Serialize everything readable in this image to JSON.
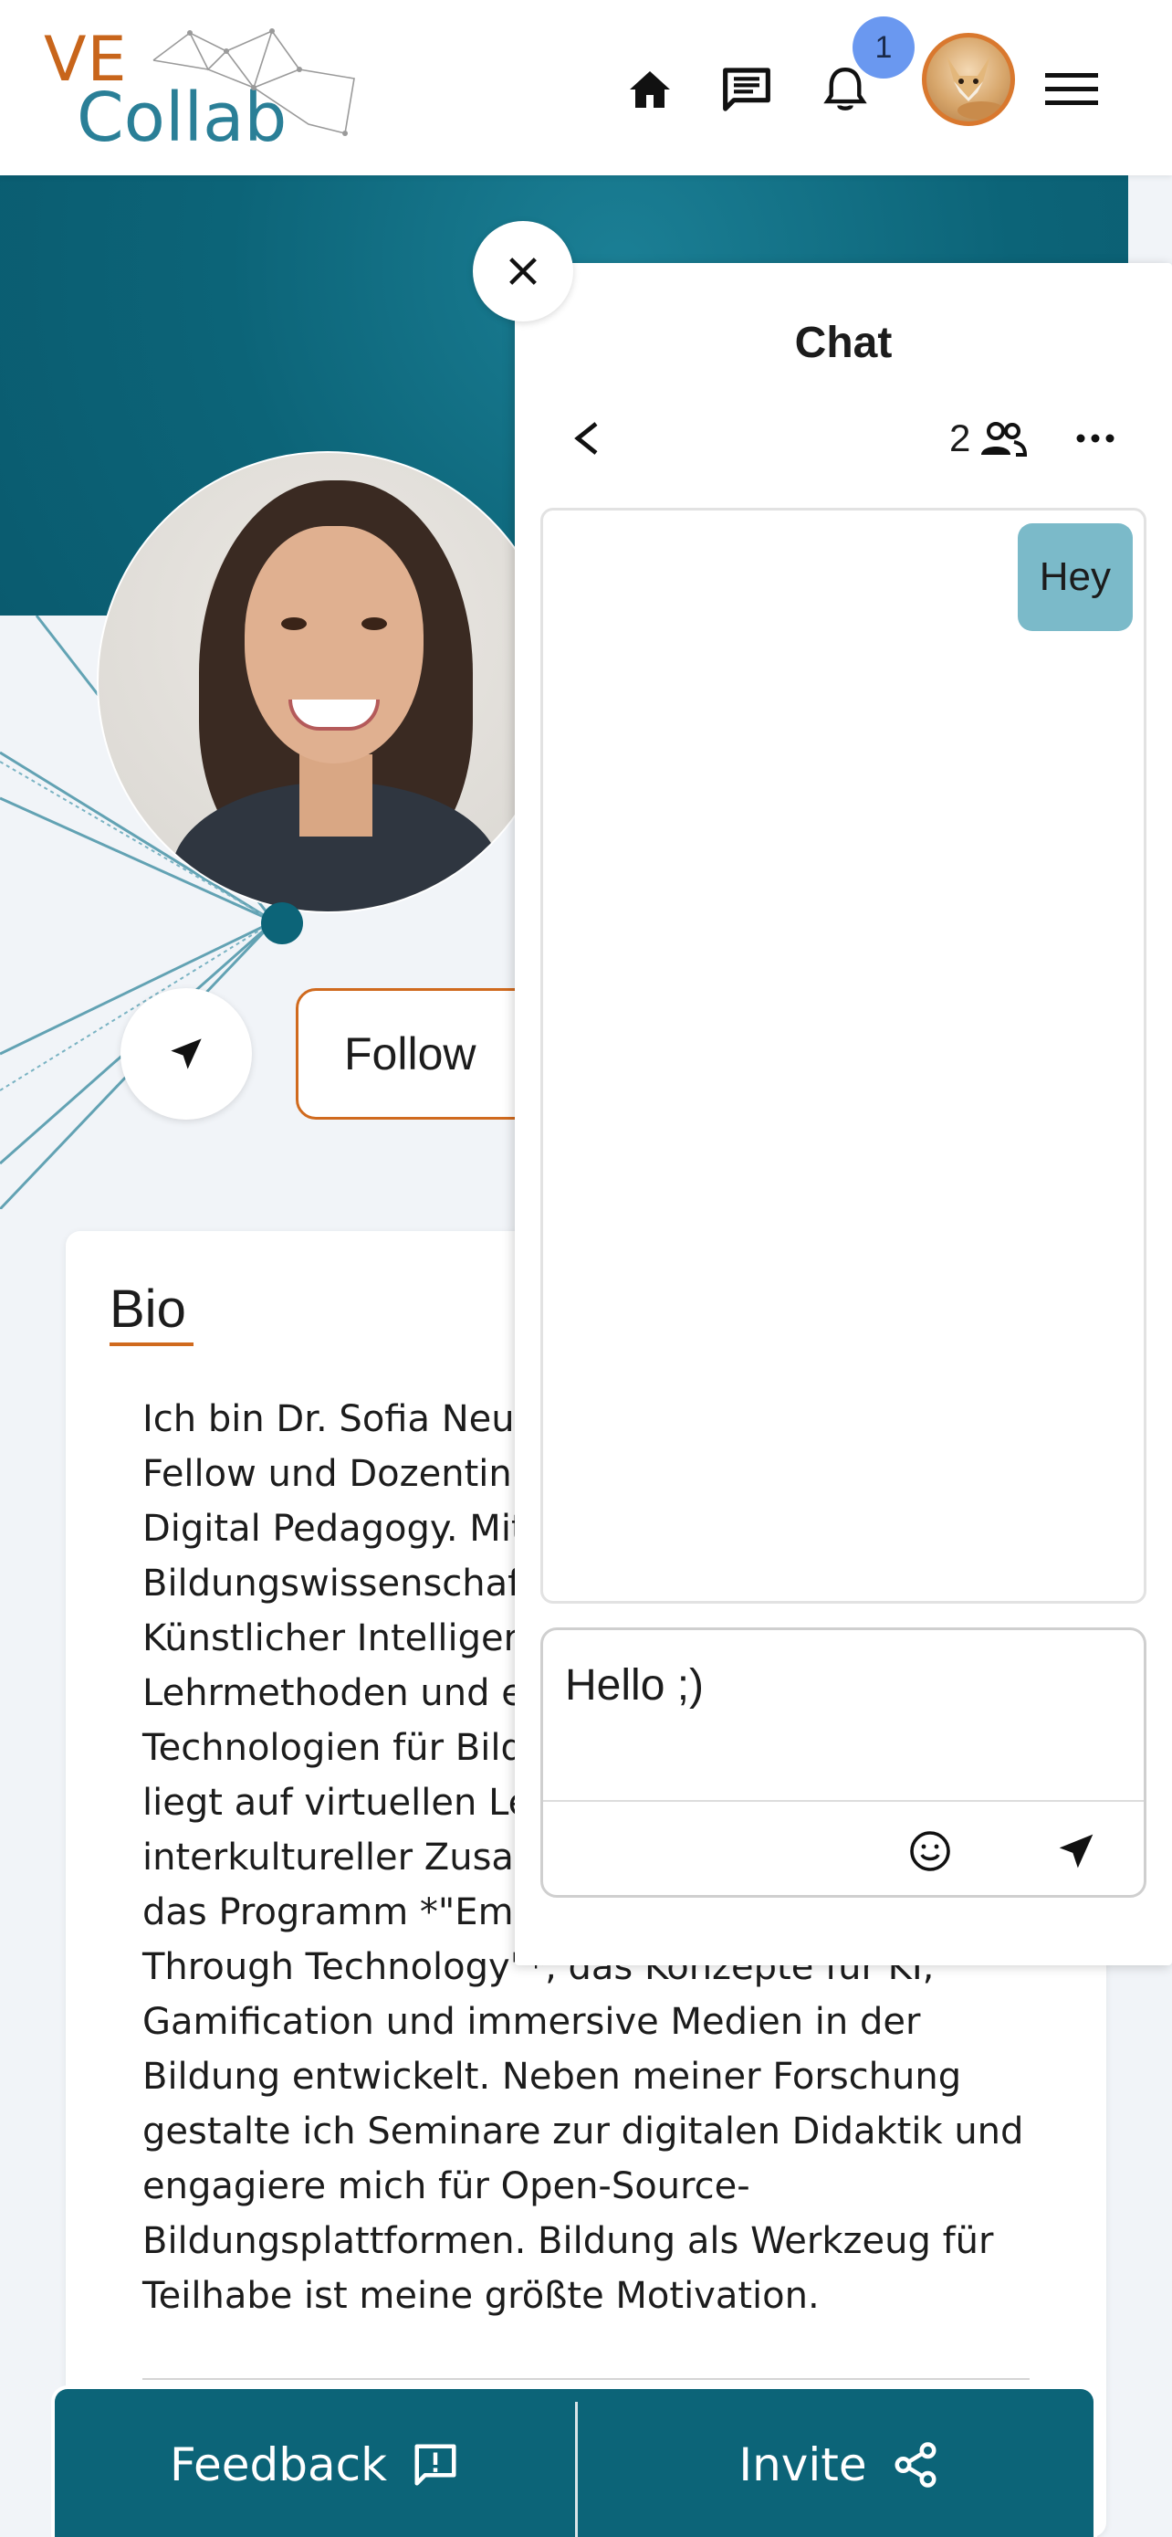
{
  "header": {
    "logo": {
      "ve": "VE",
      "collab": "Collab"
    },
    "icons": [
      "home-icon",
      "chat-icon",
      "bell-icon",
      "avatar",
      "menu-icon"
    ],
    "notification_count": "1"
  },
  "profile": {
    "follow_label": "Follow",
    "bio": {
      "title": "Bio",
      "lines": [
        "Ich bin Dr. Sofia Neur",
        "Fellow und Dozentin",
        "Digital Pedagogy. Mit",
        "Bildungswissenschaf",
        "Künstlicher Intelliger",
        "Lehrmethoden und e",
        "Technologien für Bild",
        "liegt auf virtuellen Le",
        "interkultureller Zusar",
        "das Programm *\"Em",
        "Through Technology\"*, das Konzepte für KI,",
        "Gamification und immersive Medien in der",
        "Bildung entwickelt. Neben meiner Forschung",
        "gestalte ich Seminare zur digitalen Didaktik und",
        "engagiere mich für Open-Source-",
        "Bildungsplattformen. Bildung als Werkzeug für",
        "Teilhabe ist meine größte Motivation."
      ]
    }
  },
  "chat": {
    "title": "Chat",
    "member_count": "2",
    "messages": [
      {
        "text": "Hey",
        "own": true
      }
    ],
    "composer_value": "Hello ;)"
  },
  "bottom_bar": {
    "feedback_label": "Feedback",
    "invite_label": "Invite"
  },
  "colors": {
    "primary": "#0c6478",
    "accent": "#d06a1e",
    "bubble": "#7bbac9",
    "badge": "#6a98f0"
  }
}
